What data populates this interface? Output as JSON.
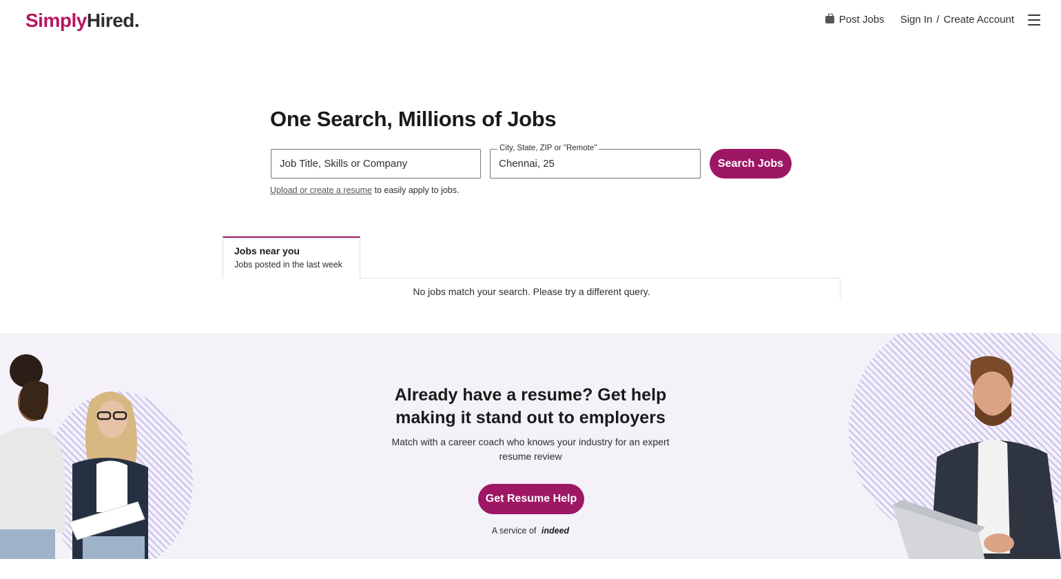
{
  "header": {
    "logo_simply": "Simply",
    "logo_hired": "Hired.",
    "post_jobs": "Post Jobs",
    "sign_in": "Sign In",
    "separator": "/",
    "create_account": "Create Account"
  },
  "search": {
    "title": "One Search, Millions of Jobs",
    "what_placeholder": "Job Title, Skills or Company",
    "where_label": "City, State, ZIP or \"Remote\"",
    "where_value": "Chennai, 25",
    "button": "Search Jobs",
    "upload_link": "Upload or create a resume",
    "upload_suffix": "to easily apply to jobs."
  },
  "tabs": {
    "active_title": "Jobs near you",
    "active_sub": "Jobs posted in the last week"
  },
  "results": {
    "empty_message": "No jobs match your search. Please try a different query."
  },
  "promo": {
    "title_line1": "Already have a resume? Get help",
    "title_line2": "making it stand out to employers",
    "sub_line1": "Match with a career coach who knows your industry for an expert",
    "sub_line2": "resume review",
    "button": "Get Resume Help",
    "service_prefix": "A service of",
    "service_brand": "indeed"
  },
  "colors": {
    "brand": "#9d1764",
    "logo_accent": "#b9155e",
    "promo_bg": "#f4f1f9"
  }
}
